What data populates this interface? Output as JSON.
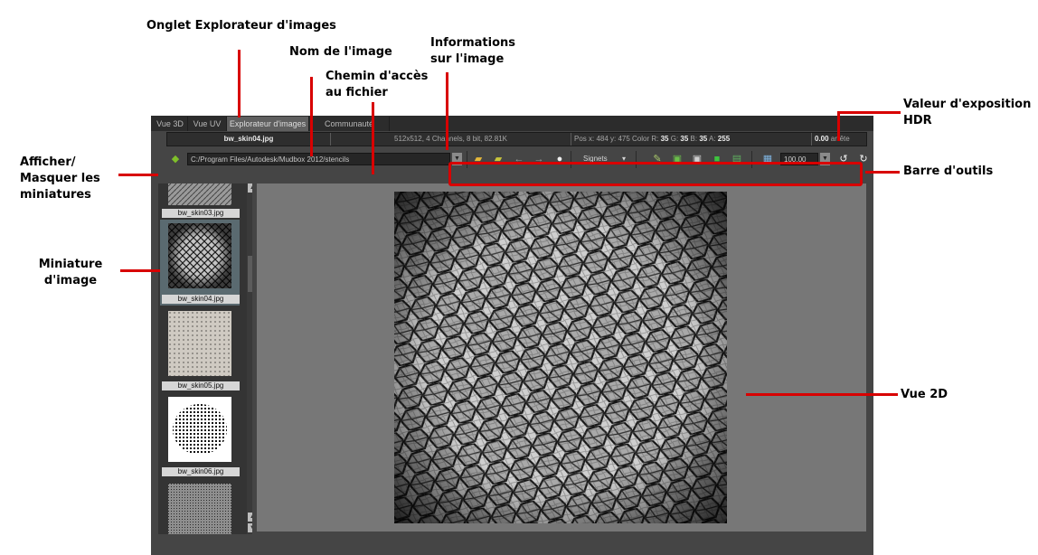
{
  "callouts": {
    "onglet": "Onglet Explorateur d'images",
    "nom": "Nom de l'image",
    "chemin_1": "Chemin d'accès",
    "chemin_2": "au fichier",
    "infos_1": "Informations",
    "infos_2": "sur l'image",
    "hdr_1": "Valeur d'exposition",
    "hdr_2": "HDR",
    "afficher_1": "Afficher/",
    "afficher_2": "Masquer les",
    "afficher_3": "miniatures",
    "barre": "Barre d'outils",
    "miniature_1": "Miniature",
    "miniature_2": "d'image",
    "vue2d": "Vue 2D"
  },
  "tabs": [
    {
      "label": "Vue 3D"
    },
    {
      "label": "Vue UV"
    },
    {
      "label": "Explorateur d'images"
    },
    {
      "label": "Communauté Mudbox"
    }
  ],
  "info_bar": {
    "image_name": "bw_skin04.jpg",
    "image_info": "512x512, 4 Channels, 8 bit,  82.81K",
    "pos_prefix": "Pos x: 484 y: 475 Color R: ",
    "r": "35",
    "g_label": " G: ",
    "g": "35",
    "b_label": " B: ",
    "b": "35",
    "a_label": " A: ",
    "a": "255",
    "exposure_value": "0.00",
    "exposure_unit": " arrête"
  },
  "toolbar": {
    "path": "C:/Program Files/Autodesk/Mudbox 2012/stencils",
    "bookmarks_label": "Signets",
    "zoom_value": "100.00"
  },
  "thumbnails": [
    {
      "label": "bw_skin03.jpg"
    },
    {
      "label": "bw_skin04.jpg"
    },
    {
      "label": "bw_skin05.jpg"
    },
    {
      "label": "bw_skin06.jpg"
    }
  ],
  "colors": {
    "callout_line": "#d80000",
    "app_background": "#3c3c3c",
    "view_background": "#777777"
  }
}
